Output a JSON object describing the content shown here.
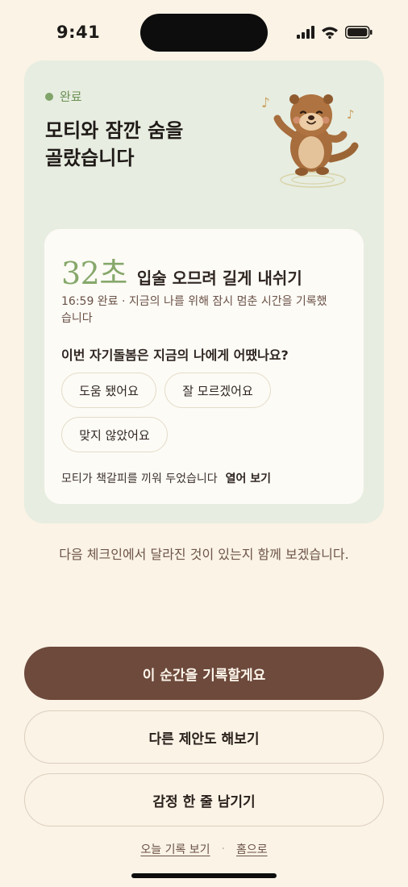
{
  "status_bar": {
    "time": "9:41",
    "icons": [
      "signal-icon",
      "wifi-icon",
      "battery-icon"
    ]
  },
  "hero": {
    "status_label": "완료",
    "title": "모티와 잠깐 숨을\n골랐습니다",
    "mascot": "otter-mascot-dancing"
  },
  "result": {
    "duration": "32초",
    "exercise": "입술 오므려 길게 내쉬기",
    "description": "16:59 완료 · 지금의 나를 위해 잠시 멈춘 시간을 기록했습니다",
    "question": "이번 자기돌봄은 지금의 나에게 어땠나요?",
    "choices": [
      "도움 됐어요",
      "잘 모르겠어요",
      "맞지 않았어요"
    ],
    "bookmark_text": "모티가 책갈피를 끼워 두었습니다",
    "bookmark_link": "열어 보기"
  },
  "next_note": "다음 체크인에서 달라진 것이 있는지 함께 보겠습니다.",
  "actions": {
    "primary": "이 순간을 기록할게요",
    "secondary_1": "다른 제안도 해보기",
    "secondary_2": "감정 한 줄 남기기"
  },
  "footer": {
    "today_link": "오늘 기록 보기",
    "separator": "·",
    "home_link": "홈으로"
  },
  "colors": {
    "background": "#faf3e6",
    "card": "#e7ede0",
    "accent_green": "#86a86b",
    "primary_brown": "#6d4a3c"
  }
}
